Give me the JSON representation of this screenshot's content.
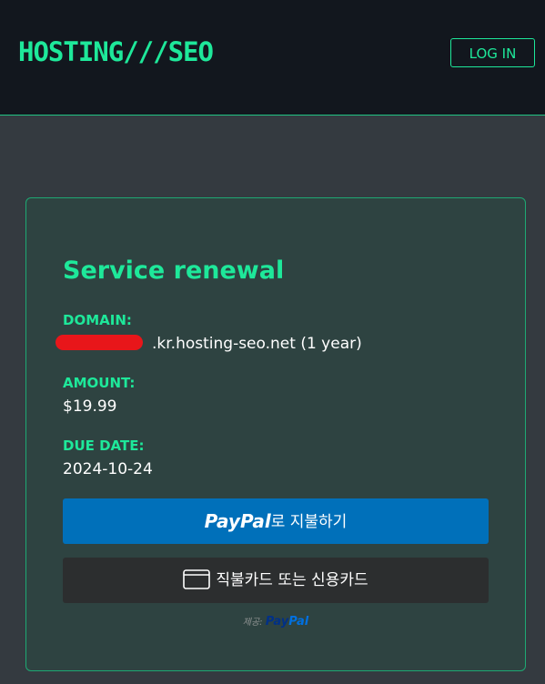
{
  "header": {
    "logo": "HOSTING///SEO",
    "login_label": "LOG IN"
  },
  "card": {
    "title": "Service renewal",
    "domain_label": "DOMAIN:",
    "domain_value": ".kr.hosting-seo.net (1 year)",
    "amount_label": "AMOUNT:",
    "amount_value": "$19.99",
    "due_label": "DUE DATE:",
    "due_value": "2024-10-24"
  },
  "paypal": {
    "logo_text_1": "Pay",
    "logo_text_2": "Pal",
    "pay_label": "로 지불하기",
    "card_label": "직불카드 또는 신용카드",
    "powered_by": "제공:",
    "powered_logo_1": "Pay",
    "powered_logo_2": "Pal"
  },
  "colors": {
    "accent": "#1ee89a",
    "header_bg": "#12171e",
    "page_bg": "#343a40",
    "card_bg": "#2e4341",
    "paypal_blue": "#0070ba",
    "card_button_bg": "#2c2e2f",
    "redaction": "#e8161a"
  }
}
